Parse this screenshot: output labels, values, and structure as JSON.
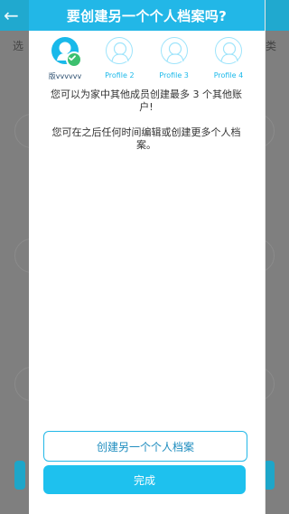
{
  "background": {
    "back_label": "←",
    "left_partial_text": "选",
    "right_partial_text": "类"
  },
  "modal": {
    "title": "要创建另一个个人档案吗?",
    "profiles": [
      {
        "label": "版vvvvvv",
        "active": true
      },
      {
        "label": "Profile 2",
        "active": false
      },
      {
        "label": "Profile 3",
        "active": false
      },
      {
        "label": "Profile 4",
        "active": false
      }
    ],
    "desc_line_1": "您可以为家中其他成员创建最多 3 个其他账户!",
    "desc_line_2": "您可在之后任何时间编辑或创建更多个人档案。",
    "buttons": {
      "create_another": "创建另一个个人档案",
      "done": "完成"
    }
  },
  "colors": {
    "accent": "#22b7e7",
    "success": "#3cc06f"
  }
}
